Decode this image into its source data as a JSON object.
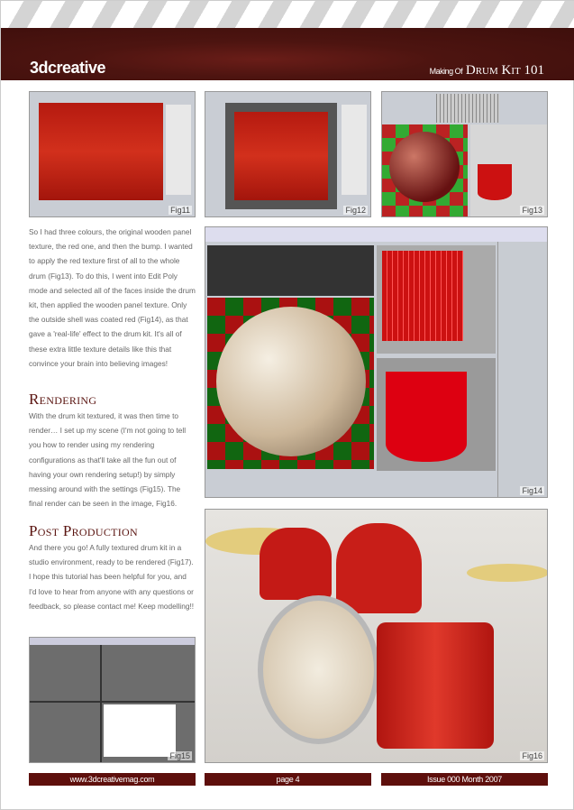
{
  "header": {
    "logo": "3dcreative",
    "making_of": "Making Of",
    "title": "Drum Kit 101"
  },
  "figures": {
    "fig11": "Fig11",
    "fig12": "Fig12",
    "fig13": "Fig13",
    "fig14": "Fig14",
    "fig15": "Fig15",
    "fig16": "Fig16"
  },
  "body": {
    "p1": "So I had three colours, the original wooden panel texture, the red one, and then the bump. I wanted to apply the red texture first of all to the whole drum (Fig13). To do this, I went into Edit Poly mode and selected all of the faces inside the drum kit, then applied the wooden panel texture. Only the outside shell was coated red (Fig14), as that gave a 'real-life' effect to the drum kit. It's all of these extra little texture details like this that convince your brain into believing images!",
    "h_rendering": "Rendering",
    "p2": "With the drum kit textured, it was then time to render… I set up my scene (I'm not going to tell you how to render using my rendering configurations as that'll take all the fun out of having your own rendering setup!) by simply messing around with the settings (Fig15). The final render can be seen in the image, Fig16.",
    "h_post": "Post Production",
    "p3": "And there you go! A fully textured drum kit in a studio environment, ready to be rendered (Fig17). I hope this tutorial has been helpful for you, and I'd love to hear from anyone with any questions or feedback, so please contact me! Keep modelling!!"
  },
  "footer": {
    "website": "www.3dcreativemag.com",
    "page": "page 4",
    "issue": "Issue 000 Month 2007"
  }
}
